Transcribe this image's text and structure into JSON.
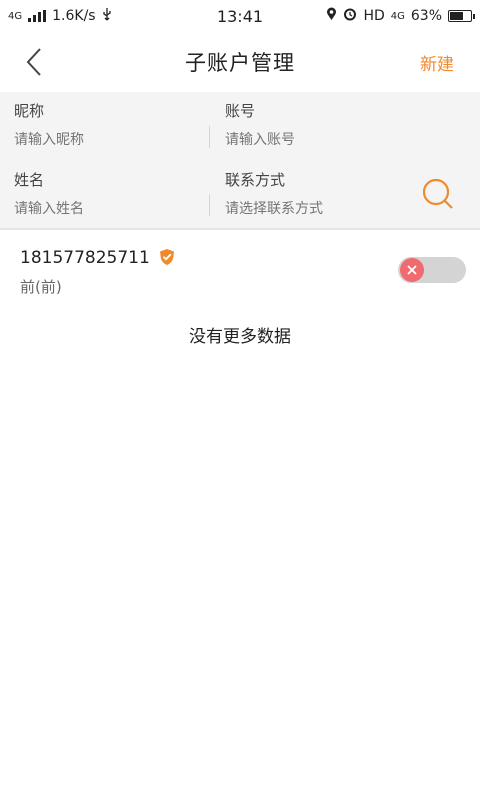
{
  "status_bar": {
    "network_type": "4G",
    "speed": "1.6K/s",
    "time": "13:41",
    "hd": "HD",
    "network_type_right": "4G",
    "battery_percent": "63%",
    "battery_level": 0.63
  },
  "header": {
    "title": "子账户管理",
    "new_label": "新建"
  },
  "filters": {
    "nickname": {
      "label": "昵称",
      "placeholder": "请输入昵称"
    },
    "account": {
      "label": "账号",
      "placeholder": "请输入账号"
    },
    "real_name": {
      "label": "姓名",
      "placeholder": "请输入姓名"
    },
    "contact": {
      "label": "联系方式",
      "placeholder": "请选择联系方式"
    }
  },
  "accounts": [
    {
      "number": "181577825711",
      "name": "前(前)",
      "enabled": false
    }
  ],
  "footer": {
    "no_more": "没有更多数据"
  },
  "colors": {
    "accent": "#f08a2c",
    "toggle_off_knob": "#f06b70",
    "panel_bg": "#f4f4f4"
  }
}
